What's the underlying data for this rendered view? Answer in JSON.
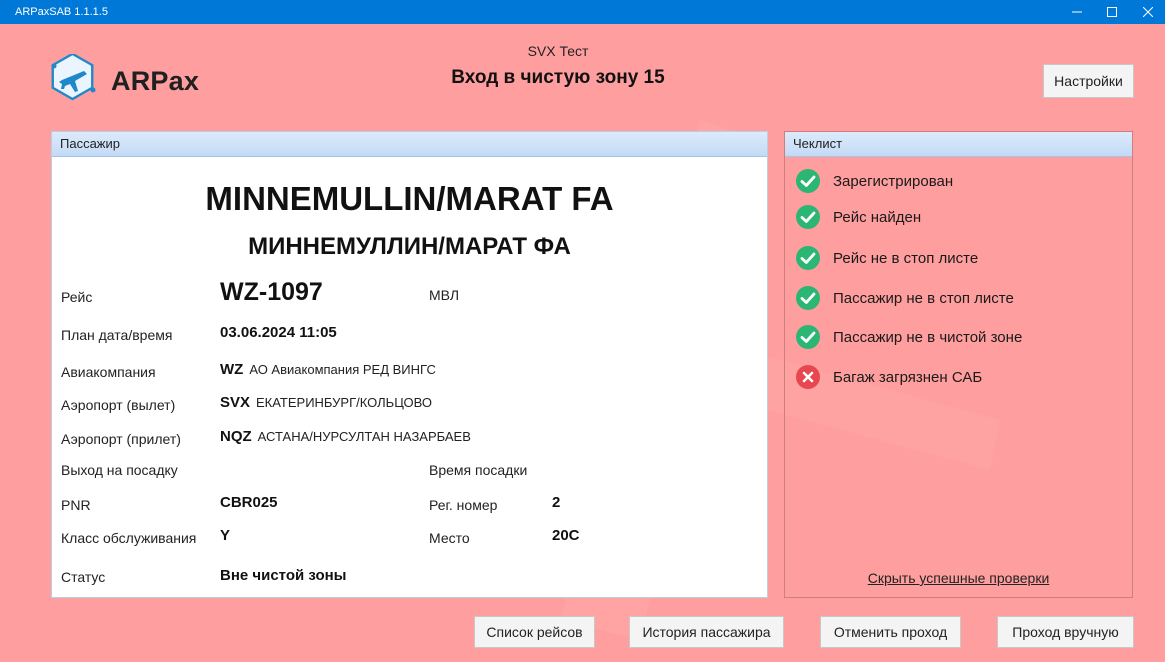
{
  "window": {
    "title": "ARPaxSAB 1.1.1.5"
  },
  "header": {
    "logo_text": "ARPax",
    "environment": "SVX Тест",
    "zone_title": "Вход в чистую зону 15",
    "settings_label": "Настройки"
  },
  "passenger": {
    "panel_title": "Пассажир",
    "name_latin": "MINNEMULLIN/MARAT FA",
    "name_cyrillic": "МИННЕМУЛЛИН/МАРАТ ФА",
    "fields": {
      "flight": {
        "label": "Рейс",
        "value": "WZ-1097",
        "extra": "МВЛ"
      },
      "planned": {
        "label": "План дата/время",
        "value": "03.06.2024 11:05"
      },
      "airline": {
        "label": "Авиакомпания",
        "code": "WZ",
        "name": "АО Авиакомпания РЕД ВИНГС"
      },
      "departure": {
        "label": "Аэропорт (вылет)",
        "code": "SVX",
        "name": "ЕКАТЕРИНБУРГ/КОЛЬЦОВО"
      },
      "arrival": {
        "label": "Аэропорт (прилет)",
        "code": "NQZ",
        "name": "АСТАНА/НУРСУЛТАН НАЗАРБАЕВ"
      },
      "gate": {
        "label": "Выход на посадку",
        "value": ""
      },
      "boarding_time": {
        "label": "Время посадки",
        "value": ""
      },
      "pnr": {
        "label": "PNR",
        "value": "CBR025"
      },
      "reg_number": {
        "label": "Рег. номер",
        "value": "2"
      },
      "service_class": {
        "label": "Класс обслуживания",
        "value": "Y"
      },
      "seat": {
        "label": "Место",
        "value": "20C"
      },
      "status": {
        "label": "Статус",
        "value": "Вне чистой зоны"
      }
    }
  },
  "checklist": {
    "panel_title": "Чеклист",
    "items": [
      {
        "label": "Зарегистрирован",
        "status": "ok",
        "icon": "check-circle-icon"
      },
      {
        "label": "Рейс найден",
        "status": "ok",
        "icon": "check-circle-icon"
      },
      {
        "label": "Рейс не в стоп листе",
        "status": "ok",
        "icon": "check-circle-icon"
      },
      {
        "label": "Пассажир не в стоп листе",
        "status": "ok",
        "icon": "check-circle-icon"
      },
      {
        "label": "Пассажир не в чистой зоне",
        "status": "ok",
        "icon": "check-circle-icon"
      },
      {
        "label": "Багаж загрязнен САБ",
        "status": "fail",
        "icon": "error-circle-icon"
      }
    ],
    "hide_link": "Скрыть успешные проверки"
  },
  "footer": {
    "flights_list": "Список рейсов",
    "passenger_history": "История пассажира",
    "cancel_pass": "Отменить проход",
    "manual_pass": "Проход вручную"
  },
  "colors": {
    "background": "#ff9e9e",
    "titlebar": "#0078d7",
    "ok": "#2bb673",
    "fail": "#e8474f",
    "panel_header": "#c3daf6"
  }
}
